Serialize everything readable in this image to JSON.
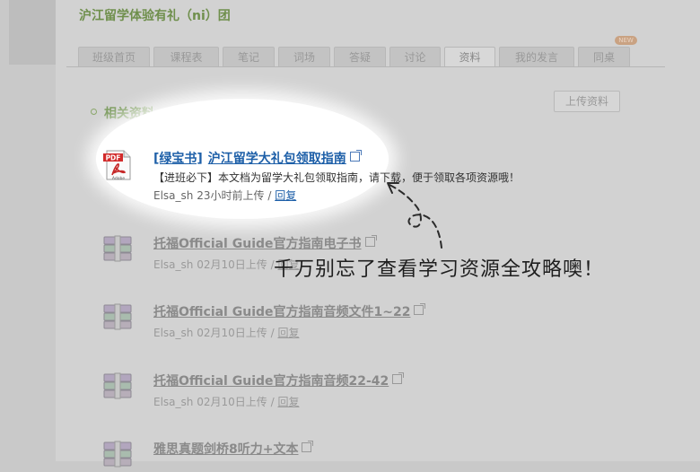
{
  "group_title": "沪江留学体验有礼（ni）团",
  "tabs": [
    {
      "label": "班级首页"
    },
    {
      "label": "课程表"
    },
    {
      "label": "笔记"
    },
    {
      "label": "词场"
    },
    {
      "label": "答疑"
    },
    {
      "label": "讨论"
    },
    {
      "label": "资料",
      "active": true
    },
    {
      "label": "我的发言"
    },
    {
      "label": "同桌",
      "badge": "NEW"
    }
  ],
  "upload_button": "上传资料",
  "section_title": "相关资料",
  "resources": [
    {
      "icon": "pdf-icon",
      "tag": "[绿宝书]",
      "name": "沪江留学大礼包领取指南",
      "description": "【进班必下】本文档为留学大礼包领取指南，请下载，便于领取各项资源哦！",
      "uploader": "Elsa_sh",
      "time": "23小时前上传",
      "separator": "/",
      "reply": "回复"
    },
    {
      "icon": "rar-archive-icon",
      "name": "托福Official Guide官方指南电子书",
      "uploader": "Elsa_sh",
      "time": "02月10日上传",
      "separator": "/",
      "reply": "回复"
    },
    {
      "icon": "rar-archive-icon",
      "name": "托福Official Guide官方指南音频文件1~22",
      "uploader": "Elsa_sh",
      "time": "02月10日上传",
      "separator": "/",
      "reply": "回复"
    },
    {
      "icon": "rar-archive-icon",
      "name": "托福Official Guide官方指南音频22-42",
      "uploader": "Elsa_sh",
      "time": "02月10日上传",
      "separator": "/",
      "reply": "回复"
    },
    {
      "icon": "rar-archive-icon",
      "name": "雅思真题剑桥8听力+文本"
    }
  ],
  "annotation_note": "千万别忘了查看学习资源全攻略噢！",
  "colors": {
    "highlight_link": "#1d5fa8",
    "overlay": "#d2d2d2",
    "section_green": "#7a9a5c"
  }
}
